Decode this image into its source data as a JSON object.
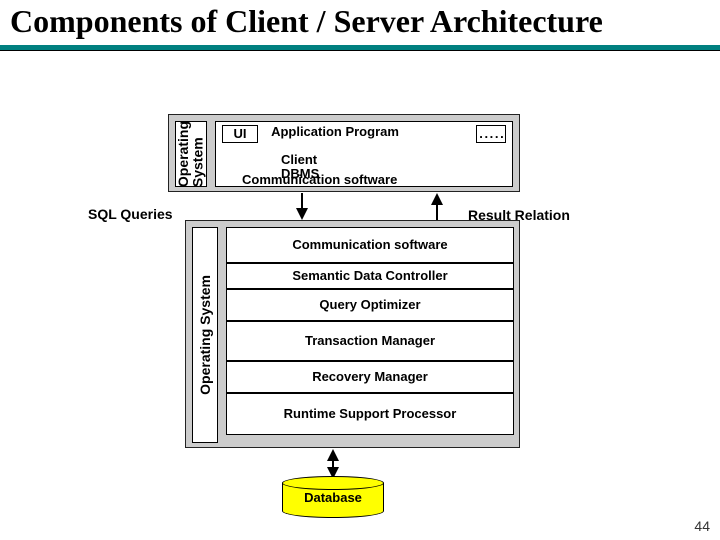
{
  "title": "Components of Client / Server Architecture",
  "client": {
    "os_label": "Operating\nSystem",
    "ui": "UI",
    "app": "Application Program",
    "dots": ". . . . .",
    "client_label": "Client",
    "dbms": "DBMS",
    "comm": "Communication software"
  },
  "labels": {
    "sql": "SQL Queries",
    "result": "Result Relation"
  },
  "server": {
    "os_label": "Operating System",
    "boxes": [
      "Communication software",
      "Semantic Data Controller",
      "Query Optimizer",
      "Transaction Manager",
      "Recovery Manager",
      "Runtime Support Processor"
    ]
  },
  "database": "Database",
  "slide_number": "44"
}
